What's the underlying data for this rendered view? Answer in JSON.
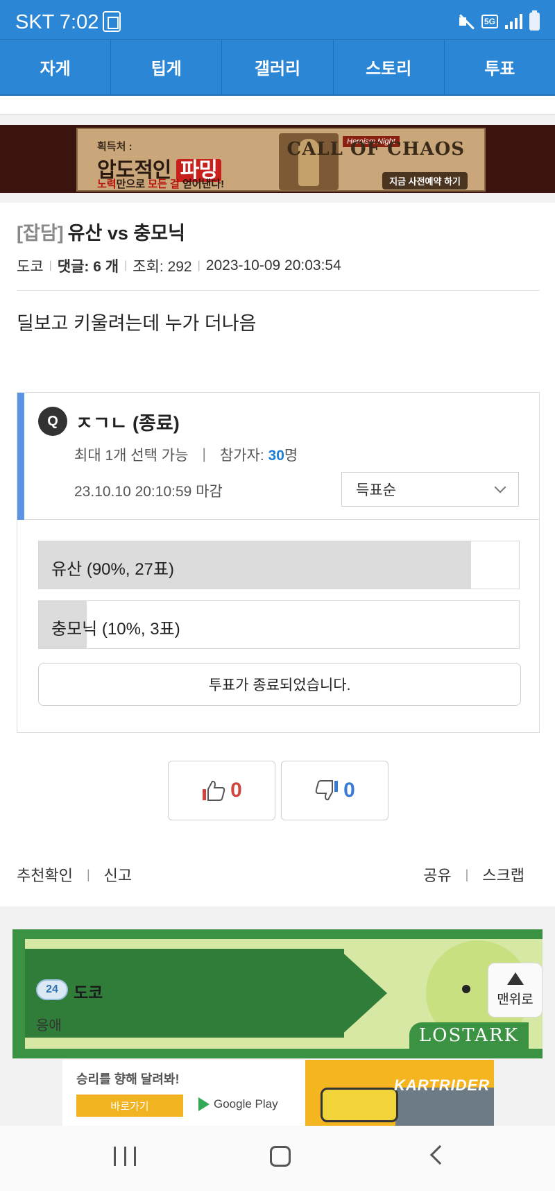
{
  "status_bar": {
    "time": "SKT 7:02",
    "network": "5G"
  },
  "nav_tabs": [
    "자게",
    "팁게",
    "갤러리",
    "스토리",
    "투표"
  ],
  "top_ad": {
    "small": "획득처 :",
    "headline_a": "압도적인",
    "headline_b": "파밍",
    "line_a": "노력",
    "line_b": "만으로",
    "line_c": "모든 걸",
    "line_d": "얻어낸다!",
    "tag": "Heroism Night",
    "logo": "CALL OF CHAOS",
    "cta": "지금 사전예약 하기"
  },
  "post": {
    "category": "[잡담]",
    "title": "유산 vs 충모닉",
    "author": "도코",
    "comments_label": "댓글: 6 개",
    "views": "조회: 292",
    "datetime": "2023-10-09 20:03:54",
    "body": "딜보고 키울려는데 누가 더나음"
  },
  "poll": {
    "icon_letter": "Q",
    "question": "ㅈㄱㄴ (종료)",
    "limit": "최대 1개 선택 가능",
    "pipe": "|",
    "participants_label": "참가자: ",
    "participants_count": "30",
    "participants_unit": "명",
    "deadline": "23.10.10 20:10:59 마감",
    "sort_selected": "득표순",
    "options": [
      {
        "label": "유산 (90%, 27표)",
        "percent": 90
      },
      {
        "label": "충모닉 (10%, 3표)",
        "percent": 10
      }
    ],
    "ended_text": "투표가 종료되었습니다."
  },
  "votes": {
    "up": "0",
    "down": "0",
    "up_color": "#d0453e",
    "down_color": "#3a7bd5"
  },
  "actions": {
    "recommend_check": "추천확인",
    "report": "신고",
    "share": "공유",
    "scrap": "스크랩",
    "pipe": "|"
  },
  "author_card": {
    "level": "24",
    "name": "도코",
    "subtitle": "응애",
    "game_logo": "LOSTARK"
  },
  "to_top": "맨위로",
  "bottom_ad": {
    "text": "승리를 향해 달려봐!",
    "button": "바로가기",
    "store": "Google Play",
    "brand": "KARTRIDER"
  }
}
